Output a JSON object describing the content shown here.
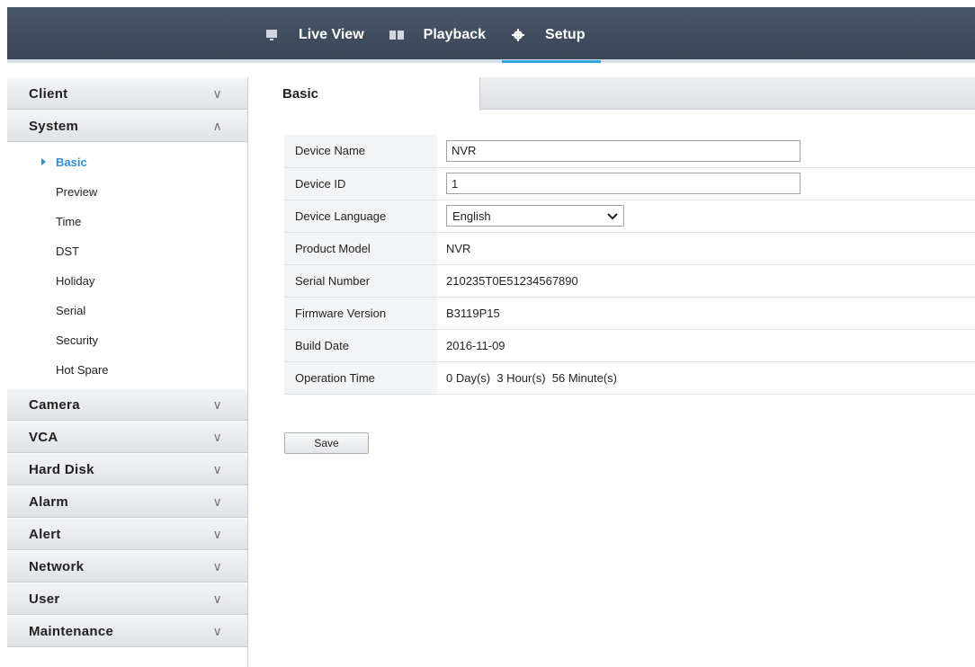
{
  "top_nav": {
    "items": [
      {
        "label": "Live View",
        "icon": "monitor-icon"
      },
      {
        "label": "Playback",
        "icon": "film-icon"
      },
      {
        "label": "Setup",
        "icon": "gear-icon",
        "active": true
      }
    ],
    "accent_color": "#30a4d8"
  },
  "sidebar": {
    "sections": [
      {
        "label": "Client",
        "expanded": false
      },
      {
        "label": "System",
        "expanded": true
      },
      {
        "label": "Camera",
        "expanded": false
      },
      {
        "label": "VCA",
        "expanded": false
      },
      {
        "label": "Hard Disk",
        "expanded": false
      },
      {
        "label": "Alarm",
        "expanded": false
      },
      {
        "label": "Alert",
        "expanded": false
      },
      {
        "label": "Network",
        "expanded": false
      },
      {
        "label": "User",
        "expanded": false
      },
      {
        "label": "Maintenance",
        "expanded": false
      }
    ],
    "system_items": [
      "Basic",
      "Preview",
      "Time",
      "DST",
      "Holiday",
      "Serial",
      "Security",
      "Hot Spare"
    ],
    "active_item": "Basic"
  },
  "main": {
    "tab_label": "Basic",
    "fields": {
      "device_name": {
        "label": "Device Name",
        "value": "NVR"
      },
      "device_id": {
        "label": "Device ID",
        "value": "1"
      },
      "device_language": {
        "label": "Device Language",
        "value": "English"
      },
      "product_model": {
        "label": "Product Model",
        "value": "NVR"
      },
      "serial_number": {
        "label": "Serial Number",
        "value": "210235T0E51234567890"
      },
      "firmware_version": {
        "label": "Firmware Version",
        "value": "B3119P15"
      },
      "build_date": {
        "label": "Build Date",
        "value": "2016-11-09"
      },
      "operation_time": {
        "label": "Operation Time",
        "value": "0 Day(s)  3 Hour(s)  56 Minute(s)"
      }
    },
    "save_label": "Save"
  }
}
